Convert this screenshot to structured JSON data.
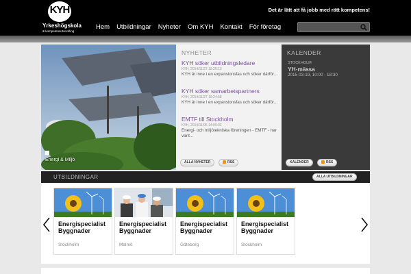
{
  "brand": {
    "logo_mark": "KYH",
    "name": "Yrkeshögskola",
    "sub": "& kompetensutveckling",
    "tagline": "Det är lätt att få jobb med rätt kompetens!"
  },
  "nav": {
    "items": [
      "Hem",
      "Utbildningar",
      "Nyheter",
      "Om KYH",
      "Kontakt",
      "För företag"
    ]
  },
  "search": {
    "placeholder": ""
  },
  "hero": {
    "caption": "Energi & Miljö"
  },
  "news": {
    "title": "NYHETER",
    "items": [
      {
        "headline": "KYH söker utbildningsledare",
        "date": "KYH, 2014/11/27 19:26:13",
        "text": "KYH är inne i en expansionsfas och söker därför..."
      },
      {
        "headline": "KYH söker samarbetspartners",
        "date": "KYH, 2014/11/27 19:24:58",
        "text": "KYH är inne i en expansionsfas och söker därför..."
      },
      {
        "headline": "EMTF till Stockholm",
        "date": "KYH, 2014/11/06 14:09:02",
        "text": "Energi- och miljötekniska föreningen - EMTF - har varit..."
      }
    ],
    "all_label": "ALLA NYHETER",
    "rss_label": "RSS"
  },
  "calendar": {
    "title": "KALENDER",
    "city": "STOCKHOLM",
    "event": "YH-mässa",
    "date": "2015-03-19,  10:00 - 18:30",
    "button_label": "KALENDER",
    "rss_label": "RSS"
  },
  "education": {
    "title": "UTBILDNINGAR",
    "all_label": "ALLA UTBILDNINGAR",
    "cards": [
      {
        "title_line1": "Energispecialist",
        "title_line2": "Byggnader",
        "city": "Stockholm",
        "image": "sunflower-wind"
      },
      {
        "title_line1": "Energispecialist",
        "title_line2": "Byggnader",
        "city": "Malmö",
        "image": "engineers"
      },
      {
        "title_line1": "Energispecialist",
        "title_line2": "Byggnader",
        "city": "Göteborg",
        "image": "sunflower-wind"
      },
      {
        "title_line1": "Energispecialist",
        "title_line2": "Byggnader",
        "city": "Stockholm",
        "image": "sunflower-wind"
      }
    ]
  },
  "colors": {
    "accent_purple": "#7a4ea0",
    "rss_orange": "#f39019",
    "topbar": "#000000"
  }
}
